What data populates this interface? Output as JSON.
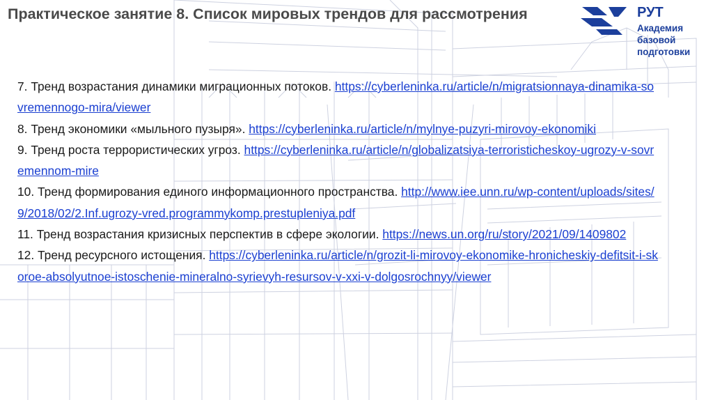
{
  "slide": {
    "title": "Практическое занятие 8. Список мировых трендов для рассмотрения"
  },
  "logo": {
    "title": "РУТ",
    "subtitle": "Академия базовой подготовки",
    "icon": "rut-logo-mark",
    "color": "#1c3f9c"
  },
  "colors": {
    "link": "#1a3fd1",
    "title": "#4a4a4a",
    "text": "#1a1a1a"
  },
  "trends": [
    {
      "text": "7. Тренд возрастания динамики миграционных потоков. ",
      "url": "https://cyberleninka.ru/article/n/migratsionnaya-dinamika-sovremennogo-mira/viewer"
    },
    {
      "text": "8. Тренд экономики «мыльного пузыря». ",
      "url": "https://cyberleninka.ru/article/n/mylnye-puzyri-mirovoy-ekonomiki"
    },
    {
      "text": "9. Тренд роста террористических угроз. ",
      "url": "https://cyberleninka.ru/article/n/globalizatsiya-terroristicheskoy-ugrozy-v-sovremennom-mire"
    },
    {
      "text": "10. Тренд формирования единого информационного пространства. ",
      "url": "http://www.iee.unn.ru/wp-content/uploads/sites/9/2018/02/2.Inf.ugrozy-vred.programmykomp.prestupleniya.pdf"
    },
    {
      "text": "11. Тренд возрастания кризисных перспектив в сфере экологии. ",
      "url": "https://news.un.org/ru/story/2021/09/1409802"
    },
    {
      "text": "12. Тренд ресурсного истощения. ",
      "url": "https://cyberleninka.ru/article/n/grozit-li-mirovoy-ekonomike-hronicheskiy-defitsit-i-skoroe-absolyutnoe-istoschenie-mineralno-syrievyh-resursov-v-xxi-v-dolgosrochnyy/viewer"
    }
  ]
}
